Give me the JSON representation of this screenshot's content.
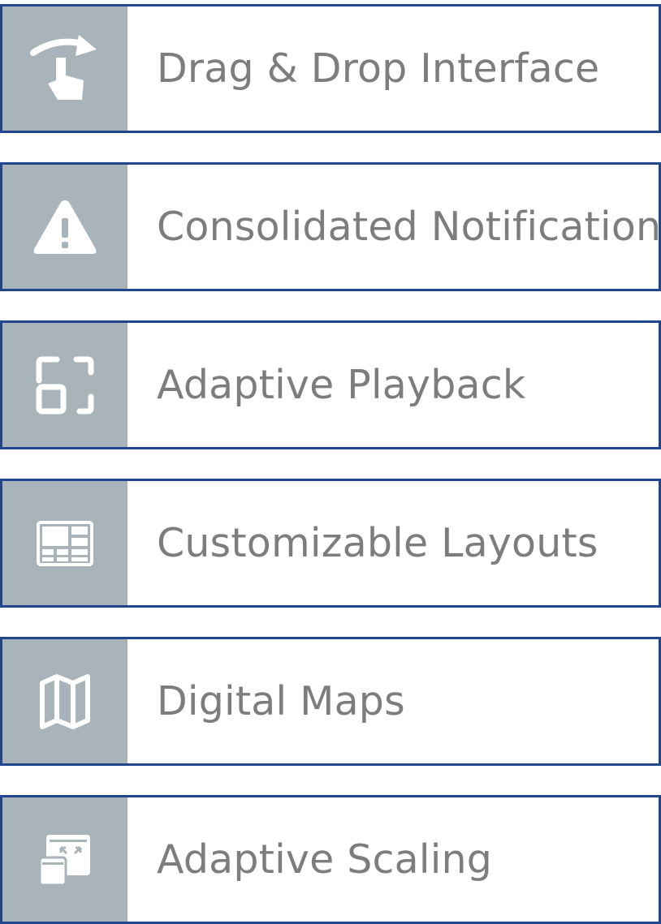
{
  "colors": {
    "border": "#21468b",
    "icon_panel": "#a8b4b9",
    "icon_glyph": "#ffffff",
    "label_text": "#7d7d7e",
    "background": "#ffffff"
  },
  "features": [
    {
      "label": "Drag & Drop Interface",
      "icon": "drag-drop-icon"
    },
    {
      "label": "Consolidated Notifications",
      "icon": "warning-icon"
    },
    {
      "label": "Adaptive Playback",
      "icon": "adaptive-playback-icon"
    },
    {
      "label": "Customizable Layouts",
      "icon": "layout-grid-icon"
    },
    {
      "label": "Digital Maps",
      "icon": "map-icon"
    },
    {
      "label": "Adaptive Scaling",
      "icon": "scaling-icon"
    }
  ]
}
